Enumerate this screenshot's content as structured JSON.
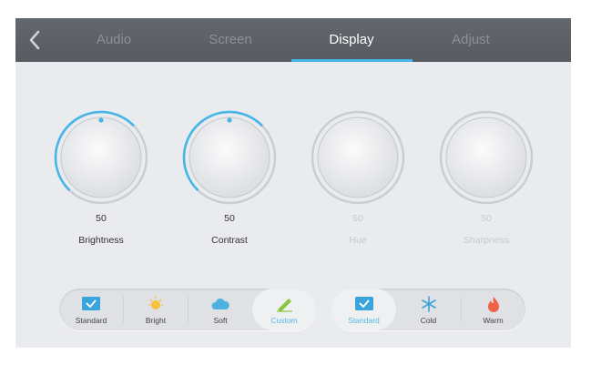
{
  "tabs": [
    {
      "label": "Audio",
      "active": false
    },
    {
      "label": "Screen",
      "active": false
    },
    {
      "label": "Display",
      "active": true
    },
    {
      "label": "Adjust",
      "active": false
    }
  ],
  "knobs": [
    {
      "value": "50",
      "label": "Brightness",
      "level": 0.5,
      "enabled": true
    },
    {
      "value": "50",
      "label": "Contrast",
      "level": 0.5,
      "enabled": true
    },
    {
      "value": "50",
      "label": "Hue",
      "level": 0.5,
      "enabled": false
    },
    {
      "value": "50",
      "label": "Sharpness",
      "level": 0.5,
      "enabled": false
    }
  ],
  "picture_modes": [
    {
      "label": "Standard",
      "icon": "standard-icon",
      "selected": false
    },
    {
      "label": "Bright",
      "icon": "sun-icon",
      "selected": false
    },
    {
      "label": "Soft",
      "icon": "cloud-icon",
      "selected": false
    },
    {
      "label": "Custom",
      "icon": "pencil-icon",
      "selected": true
    }
  ],
  "color_temps": [
    {
      "label": "Standard",
      "icon": "standard-icon",
      "selected": true
    },
    {
      "label": "Cold",
      "icon": "snowflake-icon",
      "selected": false
    },
    {
      "label": "Warm",
      "icon": "flame-icon",
      "selected": false
    }
  ],
  "colors": {
    "accent": "#46b6e6",
    "topbar": "#5c6067",
    "panel": "#e9ebee",
    "warm": "#f0614a",
    "sun": "#f5c23e"
  }
}
